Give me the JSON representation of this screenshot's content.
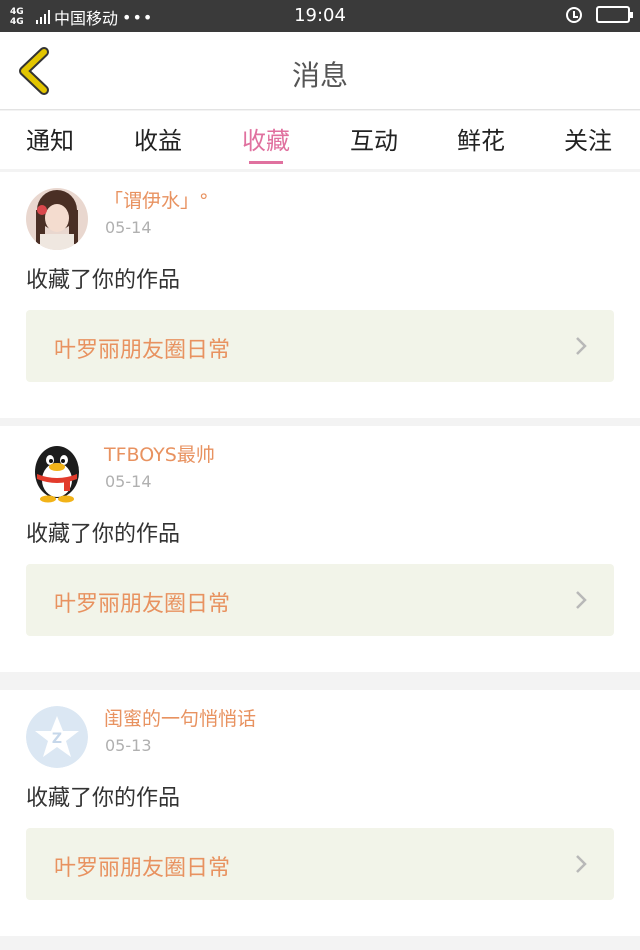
{
  "status_bar": {
    "network": "4G 4G",
    "carrier": "中国移动",
    "dots": "•••",
    "time": "19:04"
  },
  "header": {
    "title": "消息"
  },
  "tabs": [
    {
      "label": "通知",
      "active": false
    },
    {
      "label": "收益",
      "active": false
    },
    {
      "label": "收藏",
      "active": true
    },
    {
      "label": "互动",
      "active": false
    },
    {
      "label": "鲜花",
      "active": false
    },
    {
      "label": "关注",
      "active": false
    }
  ],
  "notifications": [
    {
      "user": "「谓伊水」°",
      "date": "05-14",
      "action": "收藏了你的作品",
      "work_title": "叶罗丽朋友圈日常",
      "avatar_icon": "girl-photo-avatar"
    },
    {
      "user": "TFBOYS最帅",
      "date": "05-14",
      "action": "收藏了你的作品",
      "work_title": "叶罗丽朋友圈日常",
      "avatar_icon": "penguin-avatar"
    },
    {
      "user": "闺蜜的一句悄悄话",
      "date": "05-13",
      "action": "收藏了你的作品",
      "work_title": "叶罗丽朋友圈日常",
      "avatar_icon": "default-star-avatar"
    }
  ],
  "colors": {
    "accent_pink": "#e0719f",
    "username_orange": "#e89260",
    "back_arrow": "#e2c500",
    "link_bg": "#f2f4e9"
  }
}
